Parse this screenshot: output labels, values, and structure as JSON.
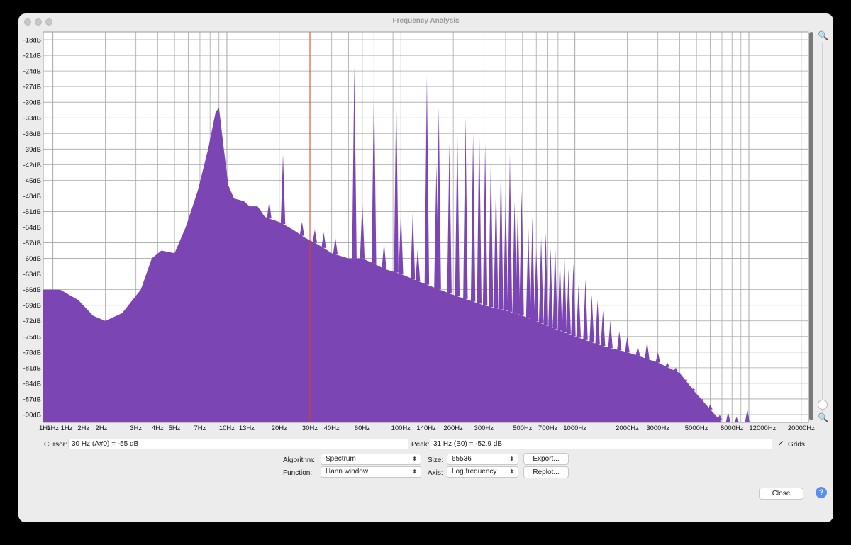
{
  "window": {
    "title": "Frequency Analysis"
  },
  "chart_data": {
    "type": "area",
    "x_scale": "log",
    "xlim": [
      0.88,
      22000
    ],
    "ylim": [
      -91.5,
      -16.5
    ],
    "grid": true,
    "y_ticks": [
      "-18dB",
      "-21dB",
      "-24dB",
      "-27dB",
      "-30dB",
      "-33dB",
      "-36dB",
      "-39dB",
      "-42dB",
      "-45dB",
      "-48dB",
      "-51dB",
      "-54dB",
      "-57dB",
      "-60dB",
      "-63dB",
      "-66dB",
      "-69dB",
      "-72dB",
      "-75dB",
      "-78dB",
      "-81dB",
      "-84dB",
      "-87dB",
      "-90dB"
    ],
    "y_tick_values": [
      -18,
      -21,
      -24,
      -27,
      -30,
      -33,
      -36,
      -39,
      -42,
      -45,
      -48,
      -51,
      -54,
      -57,
      -60,
      -63,
      -66,
      -69,
      -72,
      -75,
      -78,
      -81,
      -84,
      -87,
      -90
    ],
    "x_ticks": [
      {
        "label": "1Hz",
        "f": 0.9
      },
      {
        "label": "1Hz",
        "f": 1
      },
      {
        "label": "1Hz",
        "f": 1.2
      },
      {
        "label": "2Hz",
        "f": 1.5
      },
      {
        "label": "2Hz",
        "f": 1.9
      },
      {
        "label": "3Hz",
        "f": 3
      },
      {
        "label": "4Hz",
        "f": 4
      },
      {
        "label": "5Hz",
        "f": 5
      },
      {
        "label": "7Hz",
        "f": 7
      },
      {
        "label": "10Hz",
        "f": 10
      },
      {
        "label": "13Hz",
        "f": 13
      },
      {
        "label": "20Hz",
        "f": 20
      },
      {
        "label": "30Hz",
        "f": 30
      },
      {
        "label": "40Hz",
        "f": 40
      },
      {
        "label": "60Hz",
        "f": 60
      },
      {
        "label": "100Hz",
        "f": 100
      },
      {
        "label": "140Hz",
        "f": 140
      },
      {
        "label": "200Hz",
        "f": 200
      },
      {
        "label": "300Hz",
        "f": 300
      },
      {
        "label": "500Hz",
        "f": 500
      },
      {
        "label": "700Hz",
        "f": 700
      },
      {
        "label": "1000Hz",
        "f": 1000
      },
      {
        "label": "2000Hz",
        "f": 2000
      },
      {
        "label": "3000Hz",
        "f": 3000
      },
      {
        "label": "5000Hz",
        "f": 5000
      },
      {
        "label": "8000Hz",
        "f": 8000
      },
      {
        "label": "12000Hz",
        "f": 12000
      },
      {
        "label": "20000Hz",
        "f": 20000
      }
    ],
    "cursor_line_hz": 30,
    "envelope": [
      [
        0.88,
        -66
      ],
      [
        1.1,
        -66
      ],
      [
        1.4,
        -68
      ],
      [
        1.7,
        -71
      ],
      [
        2.0,
        -72
      ],
      [
        2.5,
        -70.5
      ],
      [
        3.2,
        -66
      ],
      [
        3.7,
        -60
      ],
      [
        4.2,
        -58.5
      ],
      [
        5.0,
        -59
      ],
      [
        5.8,
        -54
      ],
      [
        6.8,
        -47
      ],
      [
        7.8,
        -39
      ],
      [
        8.6,
        -32
      ],
      [
        9.0,
        -31
      ],
      [
        9.6,
        -39
      ],
      [
        10.2,
        -46
      ],
      [
        11,
        -48.5
      ],
      [
        12.5,
        -49
      ],
      [
        13.5,
        -50
      ],
      [
        15,
        -50
      ],
      [
        16.5,
        -52
      ],
      [
        18,
        -52.5
      ],
      [
        20,
        -53
      ],
      [
        24,
        -54.5
      ],
      [
        28,
        -56
      ],
      [
        32,
        -57
      ],
      [
        36,
        -58
      ],
      [
        40,
        -59
      ],
      [
        50,
        -60
      ],
      [
        60,
        -60
      ],
      [
        70,
        -61
      ],
      [
        80,
        -62
      ],
      [
        100,
        -63
      ],
      [
        140,
        -65
      ],
      [
        200,
        -67
      ],
      [
        300,
        -69
      ],
      [
        400,
        -70
      ],
      [
        500,
        -71
      ],
      [
        700,
        -73
      ],
      [
        1000,
        -75
      ],
      [
        1500,
        -77
      ],
      [
        2000,
        -78
      ],
      [
        3000,
        -80
      ],
      [
        4000,
        -82
      ],
      [
        5000,
        -86
      ],
      [
        6000,
        -89
      ],
      [
        7000,
        -91.5
      ],
      [
        22000,
        -91.5
      ]
    ],
    "peaks": [
      [
        17.5,
        -49
      ],
      [
        21,
        -40
      ],
      [
        27,
        -53
      ],
      [
        32,
        -54.5
      ],
      [
        36,
        -55
      ],
      [
        42,
        -56
      ],
      [
        54,
        -23
      ],
      [
        60,
        -49
      ],
      [
        70,
        -26
      ],
      [
        80,
        -57
      ],
      [
        94,
        -28
      ],
      [
        100,
        -51
      ],
      [
        117,
        -51
      ],
      [
        125,
        -58
      ],
      [
        141,
        -25
      ],
      [
        160,
        -42
      ],
      [
        165,
        -31
      ],
      [
        190,
        -38
      ],
      [
        211,
        -35
      ],
      [
        235,
        -33
      ],
      [
        260,
        -36
      ],
      [
        282,
        -34
      ],
      [
        305,
        -38
      ],
      [
        329,
        -40
      ],
      [
        352,
        -45
      ],
      [
        376,
        -41
      ],
      [
        400,
        -47
      ],
      [
        423,
        -40
      ],
      [
        450,
        -49
      ],
      [
        470,
        -50
      ],
      [
        494,
        -47
      ],
      [
        540,
        -54
      ],
      [
        570,
        -52
      ],
      [
        600,
        -58
      ],
      [
        640,
        -56
      ],
      [
        680,
        -55
      ],
      [
        725,
        -58
      ],
      [
        770,
        -57
      ],
      [
        820,
        -60
      ],
      [
        870,
        -59
      ],
      [
        920,
        -62
      ],
      [
        980,
        -61
      ],
      [
        1050,
        -65
      ],
      [
        1150,
        -64
      ],
      [
        1250,
        -67
      ],
      [
        1350,
        -68
      ],
      [
        1450,
        -70
      ],
      [
        1600,
        -72
      ],
      [
        1800,
        -74
      ],
      [
        2000,
        -75
      ],
      [
        2300,
        -77
      ],
      [
        2600,
        -76
      ],
      [
        3000,
        -78
      ],
      [
        3400,
        -80
      ],
      [
        3800,
        -81
      ],
      [
        4300,
        -84
      ],
      [
        4800,
        -85
      ],
      [
        5400,
        -87
      ],
      [
        6000,
        -88
      ],
      [
        6800,
        -90
      ],
      [
        7600,
        -89.5
      ],
      [
        8500,
        -90.5
      ],
      [
        9800,
        -89
      ]
    ]
  },
  "controls": {
    "cursor_label": "Cursor:",
    "cursor_value": "30 Hz (A#0) = -55 dB",
    "peak_label": "Peak:",
    "peak_value": "31 Hz (B0) = -52.9 dB",
    "grids_checked": true,
    "grids_label": "Grids",
    "algorithm_label": "Algorithm:",
    "algorithm_value": "Spectrum",
    "function_label": "Function:",
    "function_value": "Hann window",
    "size_label": "Size:",
    "size_value": "65536",
    "axis_label": "Axis:",
    "axis_value": "Log frequency",
    "export_label": "Export...",
    "replot_label": "Replot...",
    "close_label": "Close",
    "help_label": "?"
  },
  "colors": {
    "fill": "#7b45b3",
    "grid": "#a8a8a8",
    "cursor_line": "#e04020"
  }
}
